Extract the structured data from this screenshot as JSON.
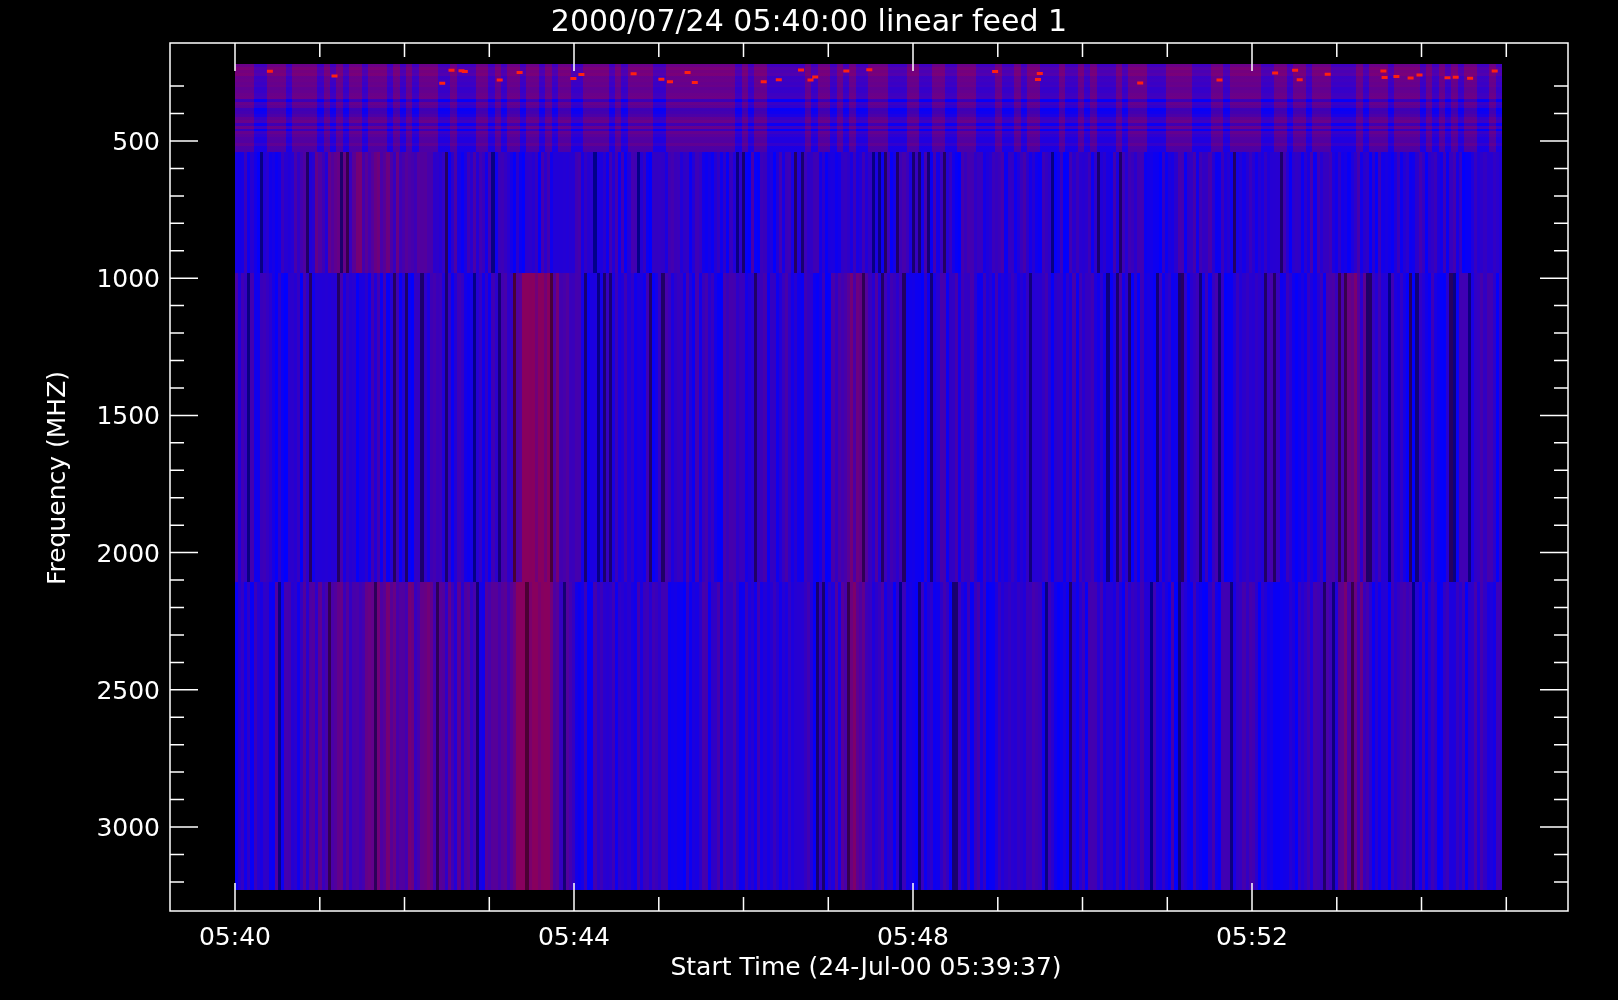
{
  "title": "2000/07/24 05:40:00 linear feed 1",
  "x_axis": {
    "label": "Start Time (24-Jul-00 05:39:37)",
    "ticks": [
      "05:40",
      "05:44",
      "05:48",
      "05:52"
    ]
  },
  "y_axis": {
    "label": "Frequency (MHZ)",
    "ticks": [
      "500",
      "1000",
      "1500",
      "2000",
      "2500",
      "3000"
    ]
  }
}
